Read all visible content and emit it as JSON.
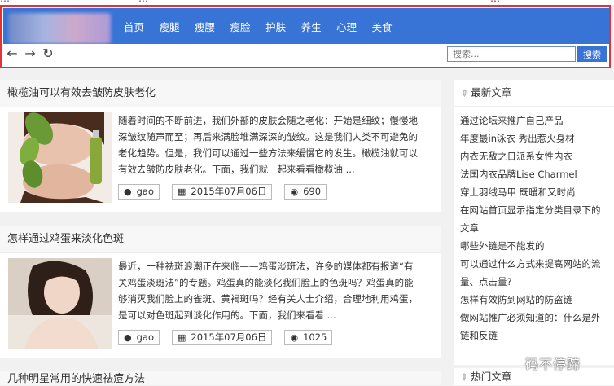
{
  "top_strip": [
    "…",
    "…",
    "…"
  ],
  "nav": {
    "items": [
      "首页",
      "瘦腿",
      "瘦腰",
      "瘦脸",
      "护肤",
      "养生",
      "心理",
      "美食"
    ]
  },
  "toolbar": {
    "back_icon": "←",
    "forward_icon": "→",
    "refresh_icon": "↻"
  },
  "search": {
    "placeholder": "搜索...",
    "button": "搜索"
  },
  "articles": [
    {
      "title": "橄榄油可以有效去皱防皮肤老化",
      "excerpt": "随着时间的不断前进，我们外部的皮肤会随之老化：开始是细纹；慢慢地深皱纹随声而至；再后来满脸堆满深深的皱纹。这是我们人类不可避免的老化趋势。但是，我们可以通过一些方法来缓慢它的发生。橄榄油就可以有效去皱防皮肤老化。下面，我们就一起来看看橄榄油 ...",
      "author": "gao",
      "date": "2015年07月06日",
      "views": "690"
    },
    {
      "title": "怎样通过鸡蛋来淡化色斑",
      "excerpt": "最近，一种祛斑浪潮正在来临——鸡蛋淡斑法，许多的媒体都有报道“有关鸡蛋淡斑法”的专题。鸡蛋真的能淡化我们脸上的色斑吗？鸡蛋真的能够消灭我们脸上的雀斑、黄褐斑吗？经有关人士介绍，合理地利用鸡蛋，是可以对色斑起到淡化作用的。下面，我们来看看 ...",
      "author": "gao",
      "date": "2015年07月06日",
      "views": "1025"
    },
    {
      "title": "几种明星常用的快速祛痘方法"
    }
  ],
  "sidebar": {
    "latest_title": "最新文章",
    "latest_links": [
      "通过论坛来推广自己产品",
      "年度最in泳衣 秀出惹火身材",
      "内衣无敌之日派系女性内衣",
      "法国内衣品牌Lise Charmel",
      "穿上羽绒马甲 既暖和又时尚",
      "在网站首页显示指定分类目录下的文章",
      "哪些外链是不能发的",
      "可以通过什么方式来提高网站的流量、点击量?",
      "怎样有效防到网站的防盗链",
      "做网站推广必须知道的：什么是外链和反链"
    ],
    "hot_title": "热门文章"
  },
  "watermark": "码不停蹄",
  "colors": {
    "nav_bg": "#3873d6",
    "highlight_border": "#e0343a"
  }
}
